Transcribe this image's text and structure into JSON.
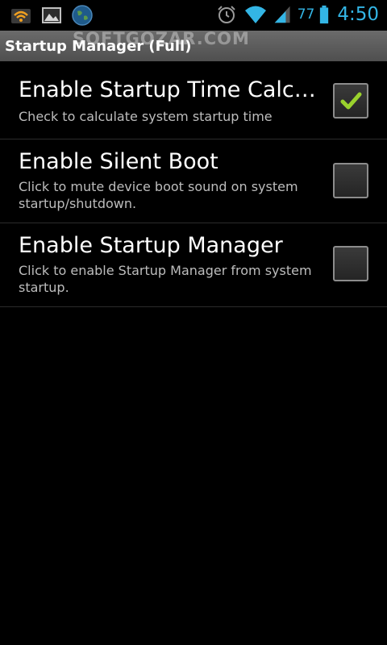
{
  "status_bar": {
    "icons_left": [
      "wifi-signal-icon",
      "image-notification-icon",
      "globe-notification-icon"
    ],
    "icons_right": [
      "alarm-clock-icon",
      "wifi-icon",
      "cell-signal-icon",
      "battery-icon"
    ],
    "battery_level": "77",
    "time": "4:50",
    "accent_color": "#33b5e5"
  },
  "titlebar": {
    "title": "Startup Manager (Full)",
    "watermark": "SOFTGOZAR.COM"
  },
  "settings": [
    {
      "title": "Enable Startup Time Calculat..",
      "summary": "Check to calculate system startup time",
      "checked": true
    },
    {
      "title": "Enable Silent Boot",
      "summary": "Click to mute device boot sound on system startup/shutdown.",
      "checked": false
    },
    {
      "title": "Enable Startup Manager",
      "summary": "Click to enable Startup Manager from system startup.",
      "checked": false
    }
  ],
  "colors": {
    "check_green": "#9ad22d",
    "background": "#000000"
  }
}
